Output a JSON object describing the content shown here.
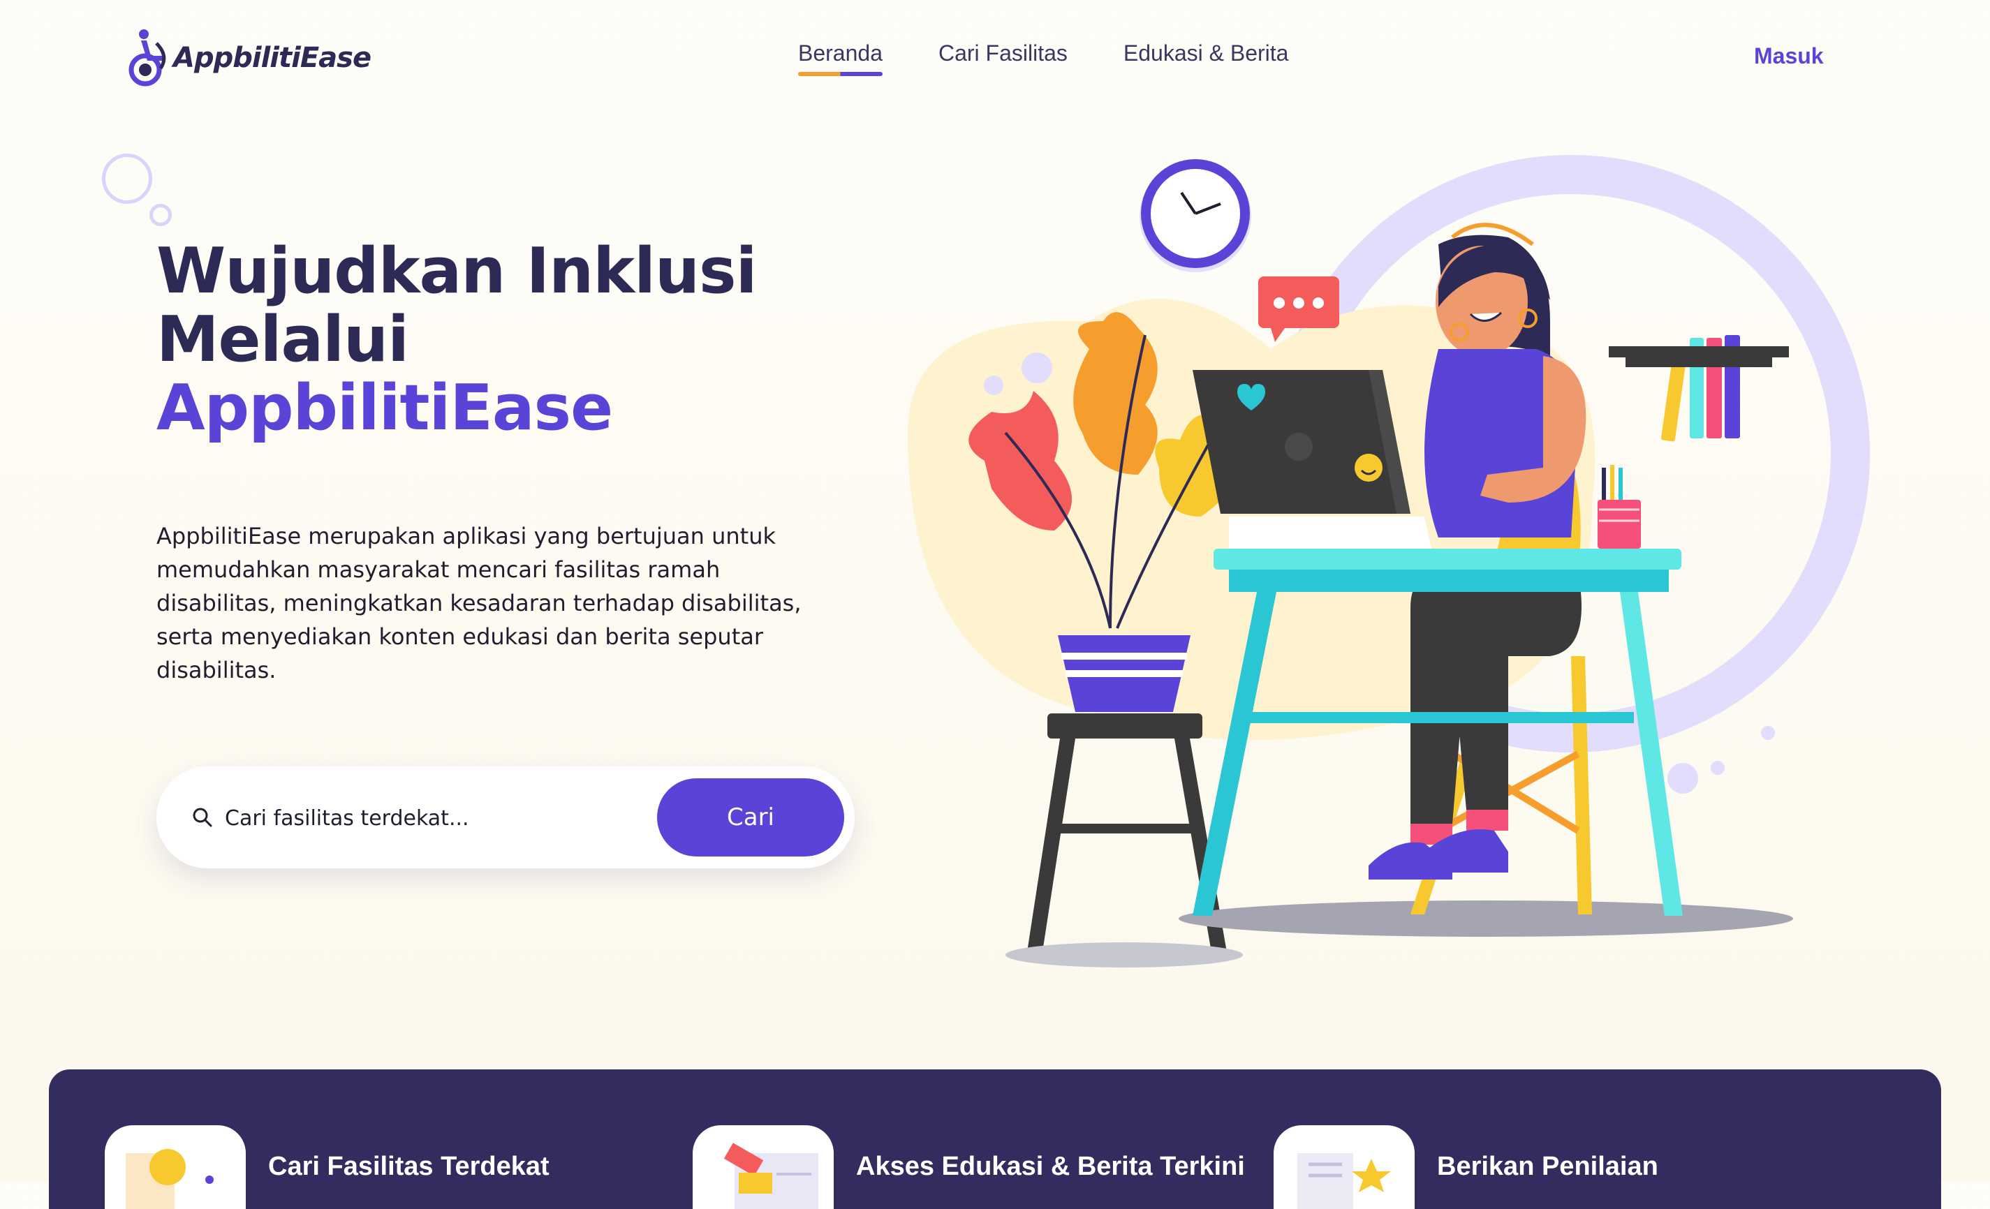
{
  "header": {
    "logo_text": "AppbilitiEase",
    "nav": [
      {
        "label": "Beranda",
        "active": true
      },
      {
        "label": "Cari Fasilitas",
        "active": false
      },
      {
        "label": "Edukasi & Berita",
        "active": false
      }
    ],
    "login_label": "Masuk"
  },
  "hero": {
    "title_line1": "Wujudkan Inklusi",
    "title_line2": "Melalui",
    "title_line3": "AppbilitiEase",
    "description": "AppbilitiEase merupakan aplikasi yang bertujuan untuk memudahkan masyarakat mencari fasilitas ramah disabilitas, meningkatkan kesadaran terhadap disabilitas, serta menyediakan konten edukasi dan berita seputar disabilitas.",
    "search": {
      "placeholder": "Cari fasilitas terdekat...",
      "value": "",
      "button_label": "Cari"
    }
  },
  "features": [
    {
      "label": "Cari Fasilitas Terdekat",
      "icon": "location-lightbulb-icon"
    },
    {
      "label": "Akses Edukasi & Berita Terkini",
      "icon": "news-book-icon"
    },
    {
      "label": "Berikan Penilaian",
      "icon": "rating-star-icon"
    }
  ],
  "colors": {
    "primary": "#5a44d8",
    "dark": "#2d2a55",
    "accent_orange": "#f59e2e",
    "band": "#322d5e"
  }
}
